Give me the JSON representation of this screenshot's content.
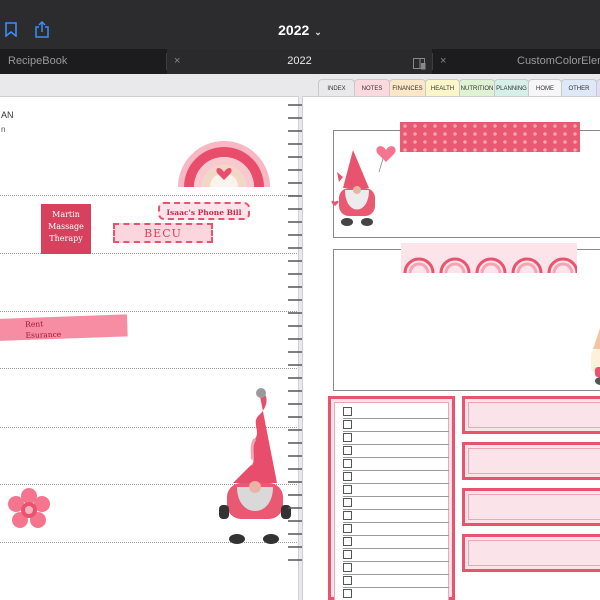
{
  "window": {
    "title": "2022",
    "title_chevron": "⌄",
    "icons": [
      "bookmark-icon",
      "share-icon"
    ]
  },
  "tabs": [
    {
      "label": "RecipeBook",
      "active": false
    },
    {
      "label": "2022",
      "active": true
    },
    {
      "label": "CustomColorEleme",
      "active": false
    }
  ],
  "tab_close_glyph": "×",
  "section_tabs": [
    {
      "label": "INDEX",
      "color": "#ffffff"
    },
    {
      "label": "NOTES",
      "color": "#fbd9de"
    },
    {
      "label": "FINANCES",
      "color": "#fde7c6"
    },
    {
      "label": "HEALTH",
      "color": "#fbf6c8"
    },
    {
      "label": "NUTRITION",
      "color": "#dff2d4"
    },
    {
      "label": "PLANNING",
      "color": "#d6efe9"
    },
    {
      "label": "HOME",
      "color": "#f6f6f8"
    },
    {
      "label": "OTHER",
      "color": "#dfe8f7"
    }
  ],
  "left_page": {
    "header_line1": "AN",
    "header_line2": "n",
    "stickers": {
      "martin": [
        "Martin",
        "Massage",
        "Therapy"
      ],
      "phone_bill": "Isaac's Phone Bill",
      "becu": "BECU",
      "rent": "Rent",
      "esurance": "Esurance"
    }
  },
  "colors": {
    "accent_pink": "#e8546e",
    "dark_pink": "#d8415d",
    "light_pink": "#fbe3ea"
  }
}
